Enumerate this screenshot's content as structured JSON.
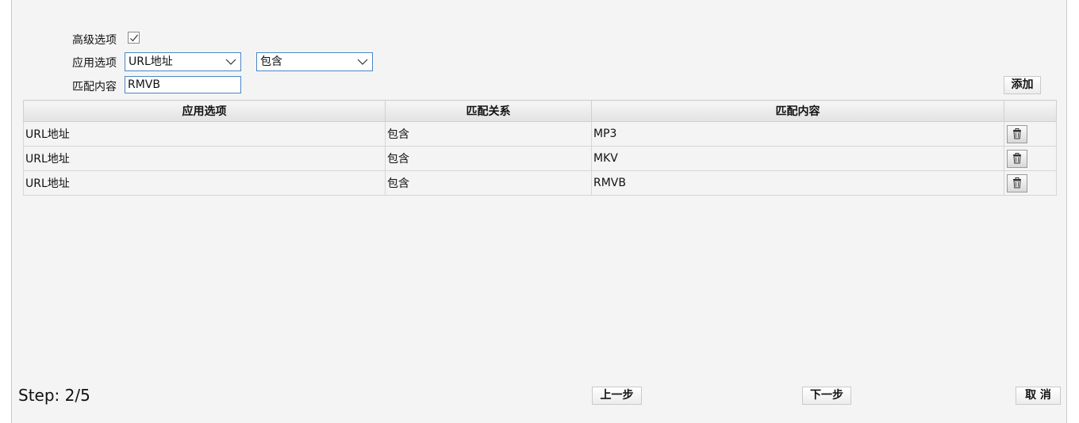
{
  "form": {
    "advanced_label": "高级选项",
    "advanced_checked": true,
    "apply_label": "应用选项",
    "apply_value": "URL地址",
    "relation_value": "包含",
    "content_label": "匹配内容",
    "content_value": "RMVB",
    "add_button": "添加"
  },
  "table": {
    "headers": [
      "应用选项",
      "匹配关系",
      "匹配内容",
      ""
    ],
    "rows": [
      {
        "option": "URL地址",
        "relation": "包含",
        "content": "MP3"
      },
      {
        "option": "URL地址",
        "relation": "包含",
        "content": "MKV"
      },
      {
        "option": "URL地址",
        "relation": "包含",
        "content": "RMVB"
      }
    ]
  },
  "footer": {
    "step": "Step: 2/5",
    "prev_button": "上一步",
    "next_button": "下一步",
    "cancel_button": "取 消"
  },
  "icons": {
    "delete": "trash-icon",
    "dropdown": "chevron-down-icon",
    "check": "checkmark-icon"
  }
}
